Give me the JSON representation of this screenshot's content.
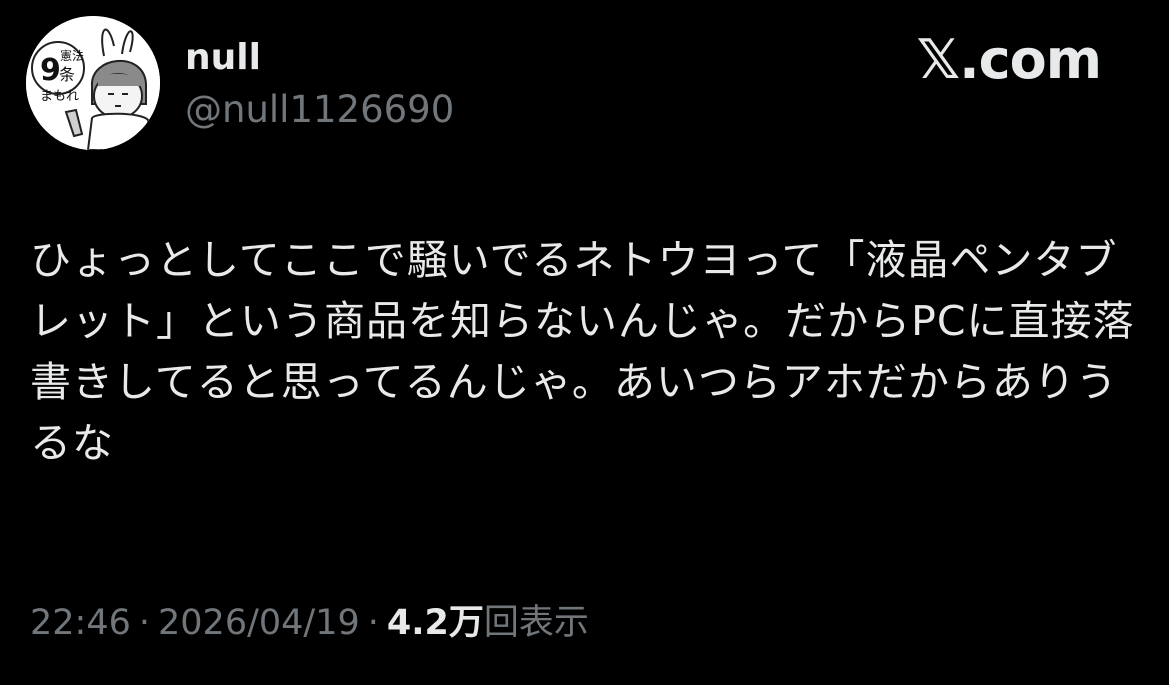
{
  "user": {
    "display_name": "null",
    "handle": "@null1126690",
    "avatar_caption": "憲法9条まもれ"
  },
  "brand": {
    "label": "𝕏.com"
  },
  "tweet": {
    "text": "ひょっとしてここで騒いでるネトウヨって「液晶ペンタブレット」という商品を知らないんじゃ。だからPCに直接落書きしてると思ってるんじゃ。あいつらアホだからありうるな"
  },
  "meta": {
    "time": "22:46",
    "date": "2026/04/19",
    "separator": "·",
    "views_count": "4.2万",
    "views_label": "回表示"
  },
  "colors": {
    "background": "#000000",
    "primary_text": "#e7e9ea",
    "secondary_text": "#71767b"
  },
  "icons": {
    "brand": "x-logo-icon",
    "avatar": "avatar-illustration"
  }
}
